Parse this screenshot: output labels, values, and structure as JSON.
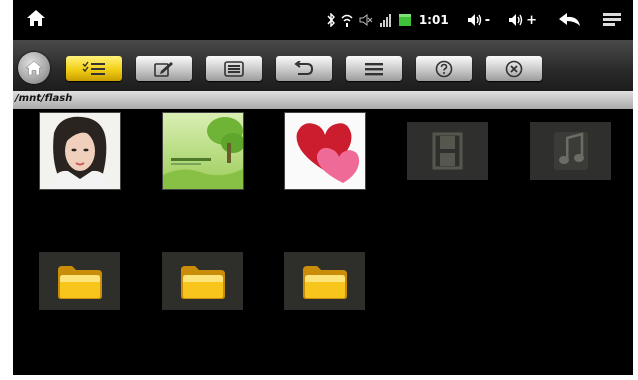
{
  "path": "/mnt/flash",
  "status": {
    "time": "1:01",
    "vol_down": "-",
    "vol_up": "+"
  },
  "icons": {
    "home": "home-icon",
    "bluetooth": "bluetooth-icon",
    "wifi": "wifi-icon",
    "mute": "speaker-muted-icon",
    "signal": "signal-icon",
    "battery": "battery-icon",
    "back": "back-arrow-icon",
    "menu": "menu-icon"
  },
  "toolbar": [
    {
      "name": "multi-select",
      "icon": "checklist-icon",
      "active": true
    },
    {
      "name": "edit",
      "icon": "edit-icon",
      "active": false
    },
    {
      "name": "list-view",
      "icon": "list-view-icon",
      "active": false
    },
    {
      "name": "undo",
      "icon": "undo-icon",
      "active": false
    },
    {
      "name": "menu",
      "icon": "menu-icon",
      "active": false
    },
    {
      "name": "help",
      "icon": "help-icon",
      "active": false
    },
    {
      "name": "close",
      "icon": "close-icon",
      "active": false
    }
  ],
  "files": [
    {
      "type": "image",
      "thumb": "portrait"
    },
    {
      "type": "image",
      "thumb": "green-tree"
    },
    {
      "type": "image",
      "thumb": "hearts"
    },
    {
      "type": "video"
    },
    {
      "type": "music"
    },
    {
      "type": "folder"
    },
    {
      "type": "folder"
    },
    {
      "type": "folder"
    }
  ],
  "colors": {
    "toolbar_active": "#f2cf16",
    "folder": "#f6c51c",
    "screen_bg": "#000000"
  }
}
